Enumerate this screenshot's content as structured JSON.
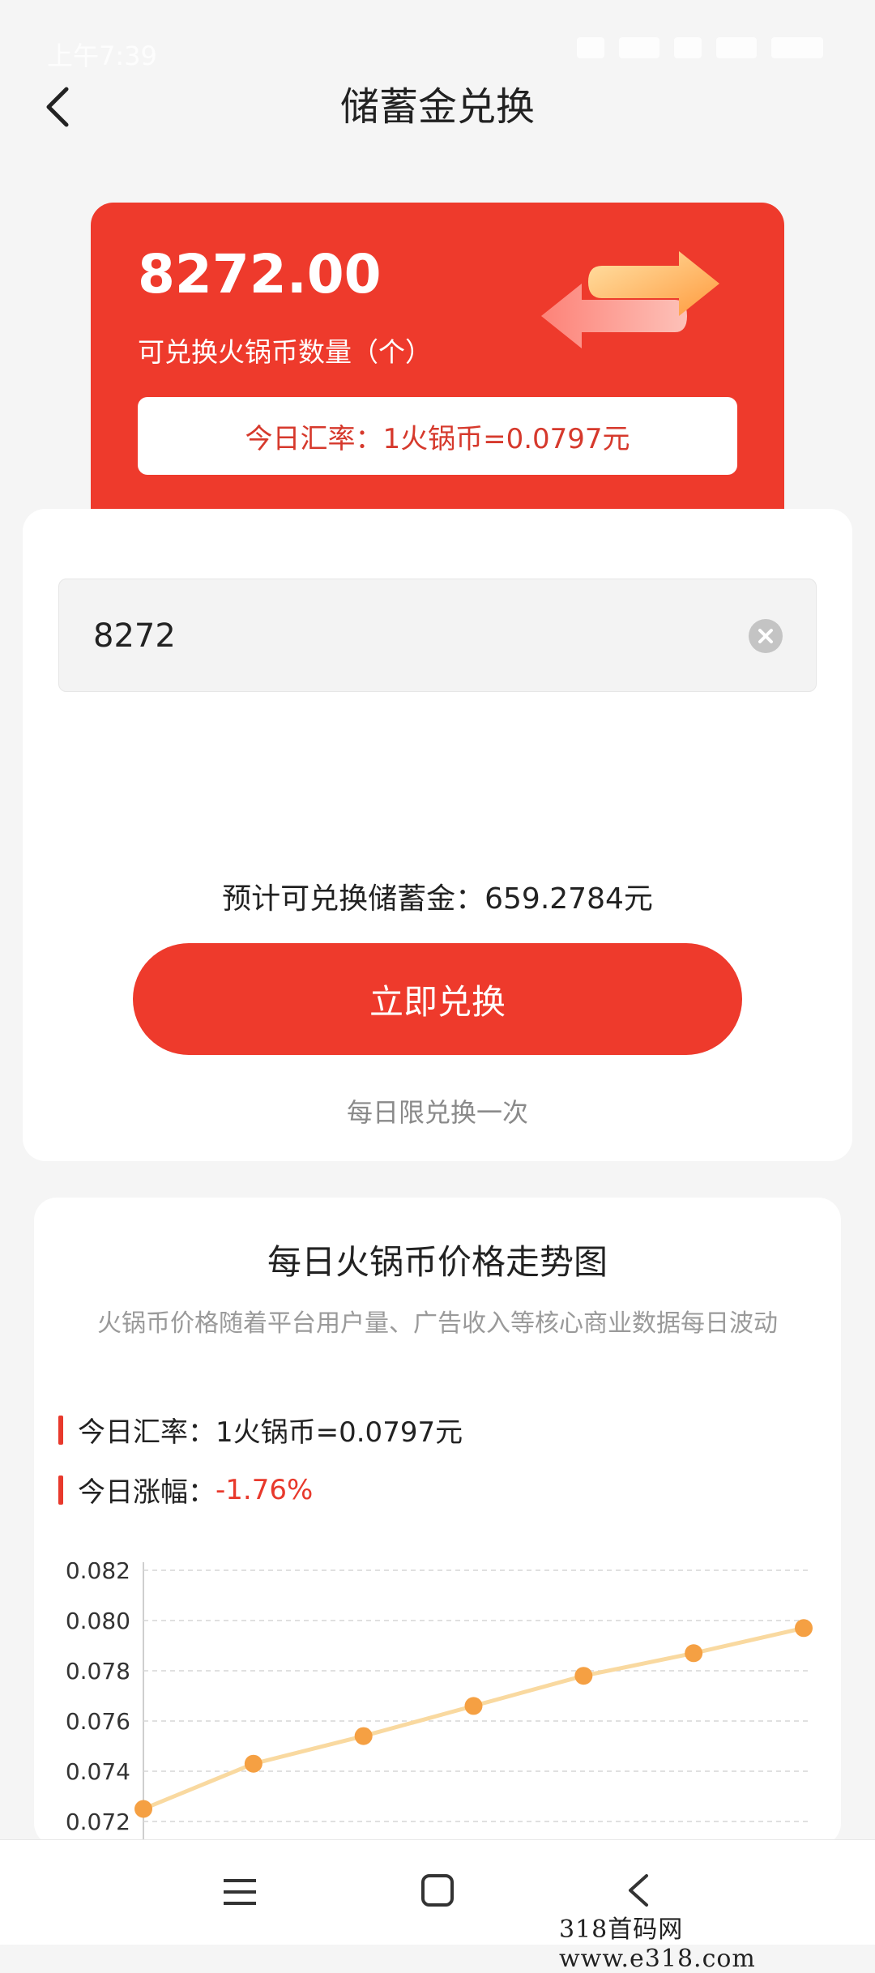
{
  "status_bar": {
    "time": "上午7:39"
  },
  "header": {
    "title": "储蓄金兑换"
  },
  "balance": {
    "amount": "8272.00",
    "label": "可兑换火锅币数量（个）",
    "rate_text": "今日汇率：1火锅币=0.0797元"
  },
  "form": {
    "input_value": "8272",
    "estimate_text": "预计可兑换储蓄金：659.2784元",
    "redeem_label": "立即兑换",
    "limit_note": "每日限兑换一次"
  },
  "trend": {
    "title": "每日火锅币价格走势图",
    "subtitle": "火锅币价格随着平台用户量、广告收入等核心商业数据每日波动",
    "rate_label": "今日汇率：",
    "rate_value": "1火锅币=0.0797元",
    "change_label": "今日涨幅：",
    "change_value": "-1.76%"
  },
  "chart_data": {
    "type": "line",
    "title": "",
    "xlabel": "",
    "ylabel": "",
    "x": [
      1,
      2,
      3,
      4,
      5,
      6,
      7
    ],
    "values": [
      0.0725,
      0.0743,
      0.0754,
      0.0766,
      0.0778,
      0.0787,
      0.0797
    ],
    "ylim": [
      0.072,
      0.082
    ],
    "yticks": [
      "0.082",
      "0.080",
      "0.078",
      "0.076",
      "0.074",
      "0.072"
    ],
    "grid": true,
    "line_color": "#f9d9a0",
    "point_color": "#f5a043"
  },
  "watermark": "318首码网  www.e318.com",
  "colors": {
    "accent": "#ee3a2c",
    "negative": "#e8392c"
  }
}
